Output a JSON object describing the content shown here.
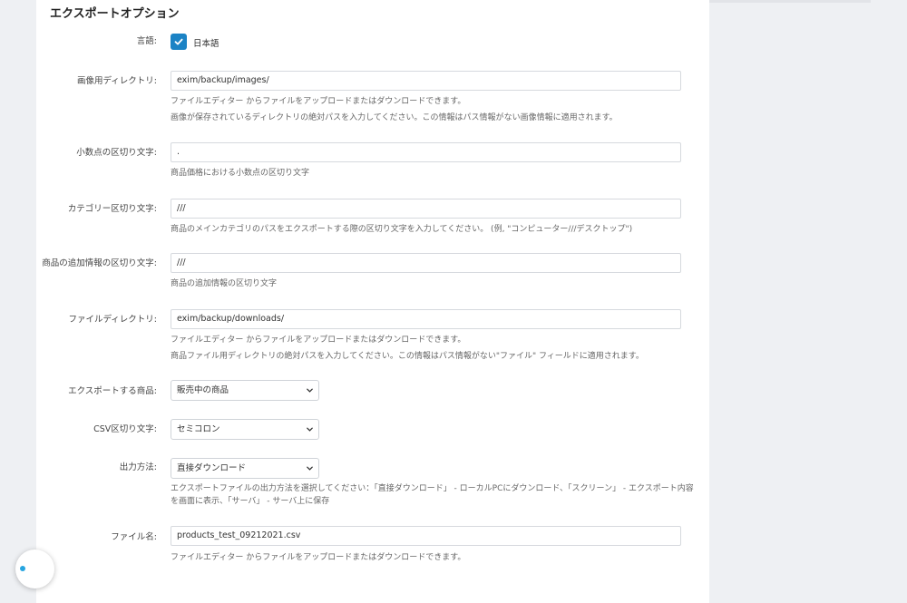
{
  "section": {
    "title": "エクスポートオプション"
  },
  "language": {
    "label": "言語:",
    "option": "日本語",
    "checked": true
  },
  "images_dir": {
    "label": "画像用ディレクトリ:",
    "value": "exim/backup/images/",
    "help1": "ファイルエディター からファイルをアップロードまたはダウンロードできます。",
    "help2": "画像が保存されているディレクトリの絶対パスを入力してください。この情報はパス情報がない画像情報に適用されます。"
  },
  "decimal": {
    "label": "小数点の区切り文字:",
    "value": ".",
    "help": "商品価格における小数点の区切り文字"
  },
  "category": {
    "label": "カテゴリー区切り文字:",
    "value": "///",
    "help": "商品のメインカテゴリのパスをエクスポートする際の区切り文字を入力してください。 (例, \"コンピューター///デスクトップ\")"
  },
  "features": {
    "label": "商品の追加情報の区切り文字:",
    "value": "///",
    "help": "商品の追加情報の区切り文字"
  },
  "files_dir": {
    "label": "ファイルディレクトリ:",
    "value": "exim/backup/downloads/",
    "help1": "ファイルエディター からファイルをアップロードまたはダウンロードできます。",
    "help2": "商品ファイル用ディレクトリの絶対パスを入力してください。この情報はパス情報がない\"ファイル\" フィールドに適用されます。"
  },
  "export_products": {
    "label": "エクスポートする商品:",
    "selected": "販売中の商品"
  },
  "csv_delimiter": {
    "label": "CSV区切り文字:",
    "selected": "セミコロン"
  },
  "output": {
    "label": "出力方法:",
    "selected": "直接ダウンロード",
    "help": "エクスポートファイルの出力方法を選択してください：「直接ダウンロード」 - ローカルPCにダウンロード、「スクリーン」 - エクスポート内容を画面に表示、「サーバ」 - サーバ上に保存"
  },
  "filename": {
    "label": "ファイル名:",
    "value": "products_test_09212021.csv",
    "help": "ファイルエディター からファイルをアップロードまたはダウンロードできます。"
  },
  "colors": {
    "accent": "#1b83c5",
    "panel": "#ffffff",
    "background": "#eef0f3"
  },
  "icons": {
    "checkbox": "checkmark-icon",
    "select": "chevron-down-icon",
    "widget": "chat-widget-icon"
  }
}
